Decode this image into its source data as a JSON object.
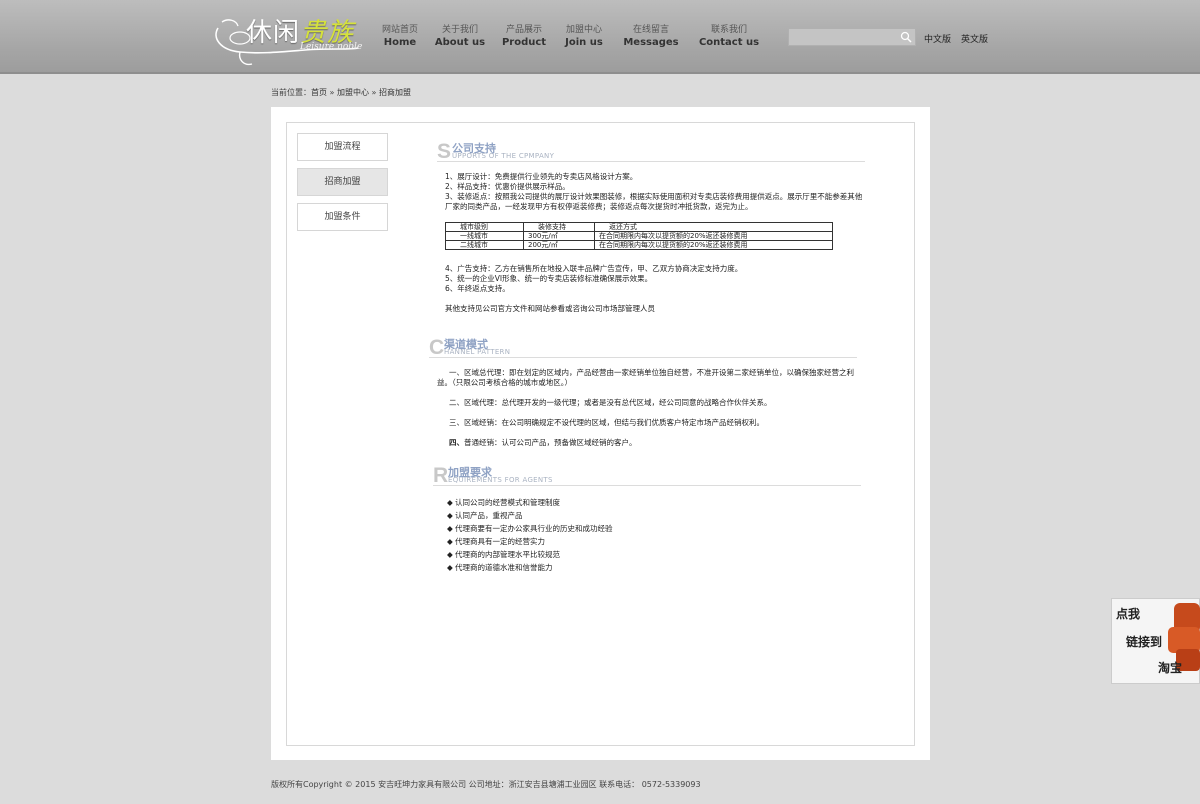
{
  "header": {
    "logo_title_a": "休闲",
    "logo_title_b": "贵族",
    "logo_sub": "Leisure noble",
    "nav": [
      {
        "cn": "网站首页",
        "en": "Home"
      },
      {
        "cn": "关于我们",
        "en": "About us"
      },
      {
        "cn": "产品展示",
        "en": "Product"
      },
      {
        "cn": "加盟中心",
        "en": "Join us"
      },
      {
        "cn": "在线留言",
        "en": "Messages"
      },
      {
        "cn": "联系我们",
        "en": "Contact us"
      }
    ],
    "search_placeholder": "",
    "lang_cn": "中文版",
    "lang_en": "英文版"
  },
  "breadcrumb": {
    "prefix": "当前位置：",
    "home": "首页",
    "sep1": " » ",
    "parent": "加盟中心",
    "sep2": " » ",
    "current": "招商加盟"
  },
  "sidebar": [
    {
      "label": "加盟流程",
      "active": false
    },
    {
      "label": "招商加盟",
      "active": true
    },
    {
      "label": "加盟条件",
      "active": false
    }
  ],
  "section1": {
    "letter": "S",
    "cn": "公司支持",
    "en": "UPPORTS OF THE CPMPANY",
    "lines": [
      "1、展厅设计：免费提供行业领先的专卖店风格设计方案。",
      "2、样品支持：优惠价提供展示样品。",
      "3、装修返点：按照我公司提供的展厅设计效果图装修，根据实际使用面积对专卖店装修费用提供返点。展示厅里不能参差其他厂家的同类产品，一经发现甲方有权停返装修费；装修返点每次提货时冲抵货款，返完为止。"
    ],
    "table": {
      "headers": [
        "城市级别",
        "装修支持",
        "返还方式"
      ],
      "rows": [
        [
          "一线城市",
          "300元/㎡",
          "在合同期限内每次以提货额的20%返还装修费用"
        ],
        [
          "二线城市",
          "200元/㎡",
          "在合同期限内每次以提货额的20%返还装修费用"
        ]
      ]
    },
    "lines2": [
      "4、广告支持：乙方在销售所在地投入联丰品牌广告宣传，甲、乙双方协商决定支持力度。",
      "5、统一的企业VI形象、统一的专卖店装修标准确保展示效果。",
      "6、年终返点支持。"
    ],
    "note": "其他支持见公司官方文件和网站参看或咨询公司市场部管理人员"
  },
  "section2": {
    "letter": "C",
    "cn": "渠道模式",
    "en": "HANNEL PATTERN",
    "p1": "一、区域总代理：即在划定的区域内，产品经营由一家经销单位独自经营，不准开设第二家经销单位，以确保独家经营之利益。（只限公司考核合格的城市或地区。）",
    "p2": "二、区域代理：总代理开发的一级代理；或者是没有总代区域，经公司同意的战略合作伙伴关系。",
    "p3": "三、区域经销：在公司明确规定不设代理的区域，但结与我们优质客户特定市场产品经销权利。",
    "p4_bold": "四、",
    "p4": "普通经销：认可公司产品，预备做区域经销的客户。"
  },
  "section3": {
    "letter": "R",
    "cn": "加盟要求",
    "en": "EQUIREMENTS FOR AGENTS",
    "items": [
      "认同公司的经营模式和管理制度",
      "认同产品，重视产品",
      "代理商要有一定办公家具行业的历史和成功经验",
      "代理商具有一定的经营实力",
      "代理商的内部管理水平比较规范",
      "代理商的道德水准和信誉能力"
    ]
  },
  "float_ad": {
    "line1": "点我",
    "line2": "链接到",
    "line3": "淘宝"
  },
  "footer": {
    "text": "版权所有Copyright © 2015 安吉旺坤力家具有限公司  公司地址：浙江安吉县塘浦工业园区  联系电话： 0572-5339093"
  }
}
